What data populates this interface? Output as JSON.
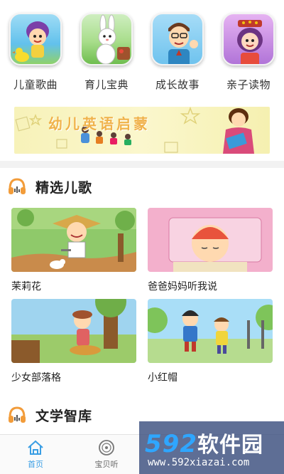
{
  "categories": [
    {
      "label": "儿童歌曲",
      "icon": "kids-songs-icon"
    },
    {
      "label": "育儿宝典",
      "icon": "parenting-guide-icon"
    },
    {
      "label": "成长故事",
      "icon": "growth-stories-icon"
    },
    {
      "label": "亲子读物",
      "icon": "family-reading-icon"
    }
  ],
  "banner": {
    "title": "幼儿英语启蒙",
    "colors": {
      "background": "#f7f2b9",
      "title": "#f0b24a"
    }
  },
  "sections": {
    "songs": {
      "title": "精选儿歌",
      "icon": "headphones-icon"
    },
    "library": {
      "title": "文学智库",
      "icon": "headphones-icon"
    }
  },
  "songs": [
    {
      "title": "茉莉花"
    },
    {
      "title": "爸爸妈妈听我说"
    },
    {
      "title": "少女部落格"
    },
    {
      "title": "小红帽"
    }
  ],
  "bottom_nav": [
    {
      "label": "首页",
      "icon": "home-icon",
      "active": true
    },
    {
      "label": "宝贝听",
      "icon": "disc-icon",
      "active": false
    }
  ],
  "watermark": {
    "brand_num": "592",
    "brand_text": "软件园",
    "url": "www.592xiazai.com"
  },
  "colors": {
    "accent": "#3a9ee4",
    "section_icon": "#f29c3a",
    "divider": "#f2f2f2"
  }
}
